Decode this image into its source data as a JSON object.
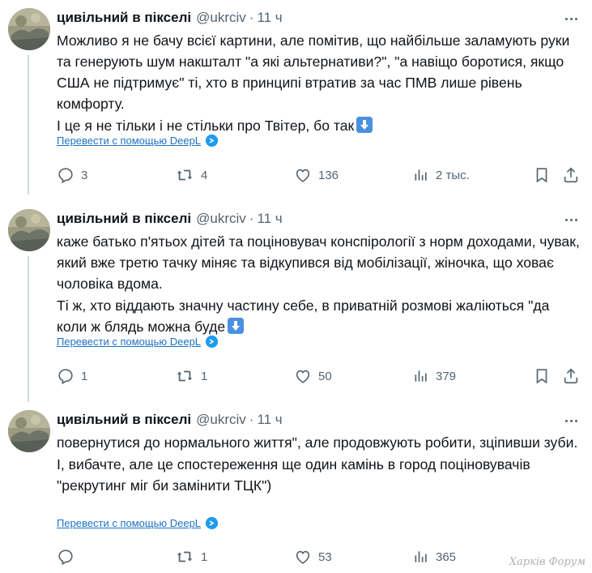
{
  "colors": {
    "link": "#1d72c4",
    "muted": "#536471",
    "text": "#0f1419",
    "emoji": "#4a90e2"
  },
  "tweets": [
    {
      "name": "цивільний в пікселі",
      "handle": "@ukrciv",
      "separator": "·",
      "time": "11 ч",
      "paragraphs": [
        "Можливо я не бачу всієї картини, але помітив, що найбільше заламують руки та генерують шум накшталт \"а які альтернативи?\", \"а навіщо боротися, якщо США не підтримує\" ті, хто в принципі втратив за час ПМВ лише рівень комфорту.",
        "І це я не тільки і не стільки про Твітер, бо так"
      ],
      "emoji": "down-arrow-emoji",
      "translate": "Перевести с помощью DeepL",
      "replies": "3",
      "reposts": "4",
      "likes": "136",
      "views": "2 тыс."
    },
    {
      "name": "цивільний в пікселі",
      "handle": "@ukrciv",
      "separator": "·",
      "time": "11 ч",
      "paragraphs": [
        "каже батько п'ятьох дітей та поціновувач конспірології з норм доходами, чувак, який вже третю тачку міняє та відкупився від мобілізації, жіночка, що ховає чоловіка вдома.",
        "Ті ж, хто віддають значну частину себе, в приватній розмові жаліються \"да коли ж блядь можна буде"
      ],
      "emoji": "down-arrow-emoji",
      "translate": "Перевести с помощью DeepL",
      "replies": "1",
      "reposts": "1",
      "likes": "50",
      "views": "379"
    },
    {
      "name": "цивільний в пікселі",
      "handle": "@ukrciv",
      "separator": "·",
      "time": "11 ч",
      "paragraphs": [
        "повернутися до нормального життя\", але продовжують робити, зціпивши зуби.",
        "І, вибачте, але це спостереження ще один камінь в город поціновувачів \"рекрутинг міг би замінити ТЦК\")"
      ],
      "translate": "Перевести с помощью DeepL",
      "replies": "",
      "reposts": "1",
      "likes": "53",
      "views": "365"
    }
  ],
  "watermark": "Харків Форум"
}
